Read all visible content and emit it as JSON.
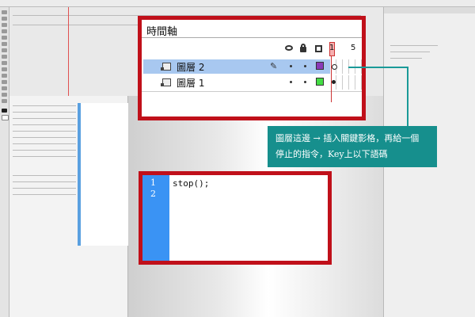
{
  "timeline": {
    "title": "時間軸",
    "frame_numbers": [
      "1",
      "5"
    ],
    "layers": [
      {
        "name": "圖層 2",
        "selected": true,
        "color": "#8a3ab8"
      },
      {
        "name": "圖層 1",
        "selected": false,
        "color": "#44dd44"
      }
    ]
  },
  "annotation": {
    "line1": "圖層這邊 → 插入關鍵影格，再給一個",
    "line2": "停止的指令，Key上以下語碼"
  },
  "actions_panel": {
    "line_numbers": [
      "1",
      "2"
    ],
    "code": "stop();"
  },
  "colors": {
    "highlight_border": "#c0101a",
    "callout_bg": "#168f8d",
    "gutter": "#3a93f4"
  }
}
